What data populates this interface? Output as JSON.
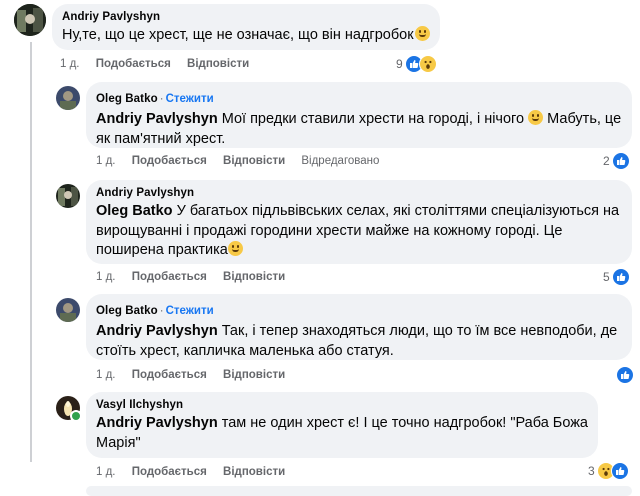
{
  "comments": [
    {
      "author": "Andriy Pavlyshyn",
      "text": "Ну,те, що це хрест, ще не означає, що він надгробок",
      "time": "1 д.",
      "like_label": "Подобається",
      "reply_label": "Відповісти",
      "reaction_count": "9"
    },
    {
      "author": "Oleg Batko",
      "follow_label": "Стежити",
      "mention": "Andriy Pavlyshyn",
      "text_part1": "Мої предки ставили хрести на городі, і нічого",
      "text_part2": "Мабуть, це як пам'ятний хрест.",
      "time": "1 д.",
      "like_label": "Подобається",
      "reply_label": "Відповісти",
      "edited_label": "Відредаговано",
      "reaction_count": "2"
    },
    {
      "author": "Andriy Pavlyshyn",
      "mention": "Oleg Batko",
      "text": "У багатьох підльвівських селах, які століттями спеціалізуються на вирощуванні і продажі городини хрести майже на кожному городі. Це поширена практика",
      "time": "1 д.",
      "like_label": "Подобається",
      "reply_label": "Відповісти",
      "reaction_count": "5"
    },
    {
      "author": "Oleg Batko",
      "follow_label": "Стежити",
      "mention": "Andriy Pavlyshyn",
      "text": "Так, і тепер знаходяться люди, що то їм все невподоби, де стоїть хрест, капличка маленька або статуя.",
      "time": "1 д.",
      "like_label": "Подобається",
      "reply_label": "Відповісти"
    },
    {
      "author": "Vasyl Ilchyshyn",
      "mention": "Andriy Pavlyshyn",
      "text": "там не один хрест є! І це точно надгробок! \"Раба Божа Марія\"",
      "time": "1 д.",
      "like_label": "Подобається",
      "reply_label": "Відповісти",
      "reaction_count": "3"
    }
  ],
  "dot": "·",
  "icons": {
    "like": "like-icon",
    "wow": "wow-icon",
    "smile": "smile-emoji"
  },
  "colors": {
    "accent": "#1877f2",
    "bubble": "#f0f2f5",
    "secondary": "#65676b"
  }
}
